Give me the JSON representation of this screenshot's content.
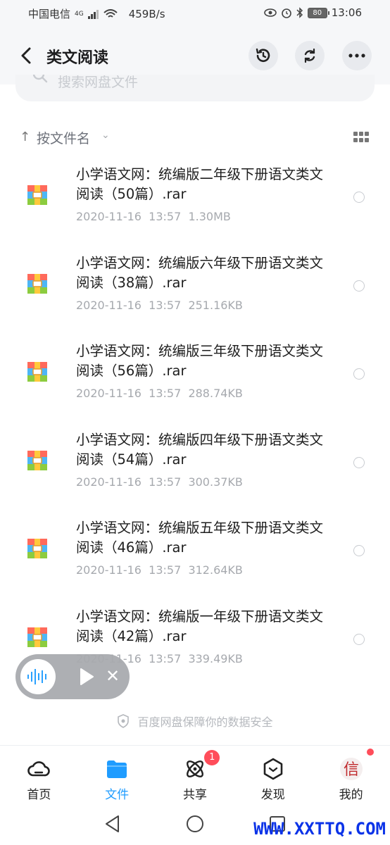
{
  "status_bar": {
    "carrier": "中国电信",
    "network": "4G",
    "speed": "459B/s",
    "battery": "80",
    "time": "13:06"
  },
  "header": {
    "title": "类文阅读"
  },
  "search": {
    "placeholder": "搜索网盘文件"
  },
  "sort": {
    "label": "按文件名"
  },
  "files": [
    {
      "name": "小学语文网：统编版二年级下册语文类文阅读（50篇）.rar",
      "date": "2020-11-16  13:57",
      "size": "1.30MB"
    },
    {
      "name": "小学语文网：统编版六年级下册语文类文阅读（38篇）.rar",
      "date": "2020-11-16  13:57",
      "size": "251.16KB"
    },
    {
      "name": "小学语文网：统编版三年级下册语文类文阅读（56篇）.rar",
      "date": "2020-11-16  13:57",
      "size": "288.74KB"
    },
    {
      "name": "小学语文网：统编版四年级下册语文类文阅读（54篇）.rar",
      "date": "2020-11-16  13:57",
      "size": "300.37KB"
    },
    {
      "name": "小学语文网：统编版五年级下册语文类文阅读（46篇）.rar",
      "date": "2020-11-16  13:57",
      "size": "312.64KB"
    },
    {
      "name": "小学语文网：统编版一年级下册语文类文阅读（42篇）.rar",
      "date": "2020-11-16  13:57",
      "size": "339.49KB"
    }
  ],
  "security_note": "百度网盘保障你的数据安全",
  "nav": {
    "home": "首页",
    "files": "文件",
    "share": "共享",
    "share_badge": "1",
    "discover": "发现",
    "me": "我的"
  },
  "watermark": "WWW.XXTTQ.COM",
  "colors": {
    "accent": "#1f9cff",
    "badge": "#ff4d5a",
    "watermark": "#0b33e8"
  }
}
